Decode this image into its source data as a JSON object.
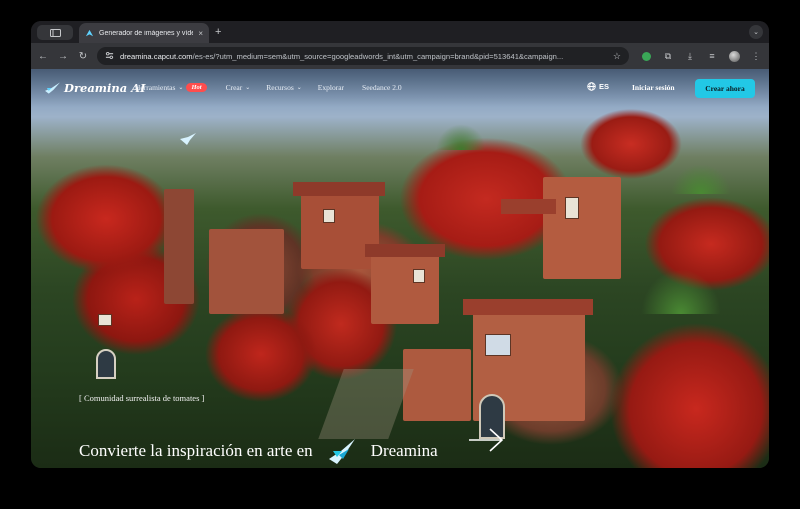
{
  "browser": {
    "tab_title": "Generador de imágenes y vídeos",
    "tab_close": "×",
    "new_tab": "+",
    "url_host": "dreamina.capcut.com",
    "url_path": "/es-es/?utm_medium=sem&utm_source=googleadwords_int&utm_campaign=brand&pid=513641&campaign..."
  },
  "nav": {
    "logo": "Dreamina AI",
    "menu": [
      {
        "label": "Herramientas",
        "badge": "Hot",
        "has_dropdown": true
      },
      {
        "label": "Crear",
        "has_dropdown": true
      },
      {
        "label": "Recursos",
        "has_dropdown": true
      },
      {
        "label": "Explorar",
        "has_dropdown": false
      },
      {
        "label": "Seedance 2.0",
        "has_dropdown": false
      }
    ],
    "language": "ES",
    "login": "Iniciar sesión",
    "cta": "Crear ahora"
  },
  "hero": {
    "scene_label": "[ Comunidad surrealista de tomates ]",
    "headline": "Convierte la inspiración en arte en",
    "brand": "Dreamina"
  },
  "colors": {
    "accent": "#22c8e6",
    "hot_badge": "#ff4d4d",
    "tomato": "#c42a20"
  },
  "icons": [
    "tab-overview-icon",
    "favicon-icon",
    "back-icon",
    "forward-icon",
    "reload-icon",
    "site-info-icon",
    "bookmark-star-icon",
    "extension-icon",
    "puzzle-icon",
    "download-icon",
    "media-icon",
    "profile-icon",
    "menu-dots-icon",
    "globe-icon",
    "chevron-down-icon",
    "arrow-right-icon"
  ]
}
